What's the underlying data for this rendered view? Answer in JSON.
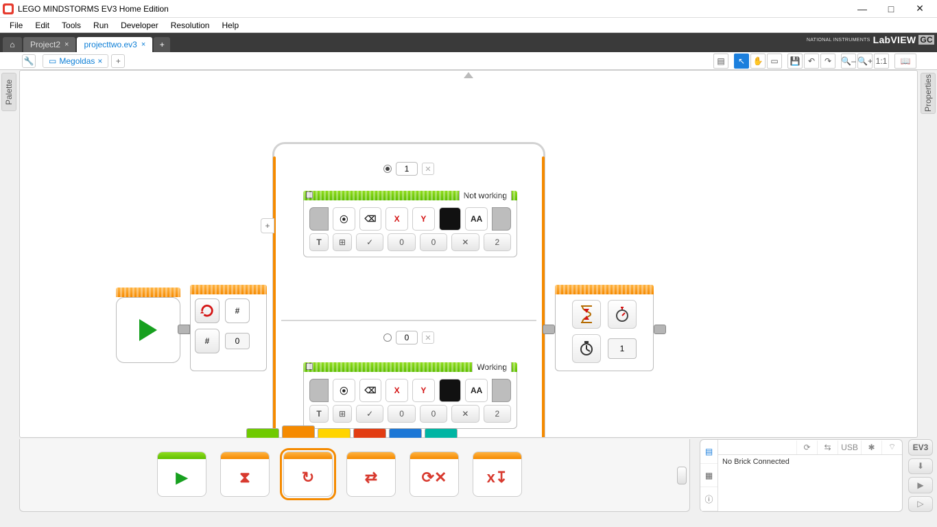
{
  "app": {
    "title": "LEGO MINDSTORMS EV3 Home Edition"
  },
  "menu": [
    "File",
    "Edit",
    "Tools",
    "Run",
    "Developer",
    "Resolution",
    "Help"
  ],
  "project_tabs": {
    "inactive": "Project2",
    "active": "projecttwo.ev3",
    "close": "×",
    "add": "+",
    "logo_main": "LabVIEW",
    "logo_over": "NATIONAL INSTRUMENTS",
    "logo_gc": "GC"
  },
  "program_tab": {
    "name": "Megoldas",
    "close": "×",
    "add": "+"
  },
  "side_tabs": {
    "left": "Palette",
    "right": "Properties"
  },
  "toolbar_icons": {
    "document": "▤",
    "pointer": "↖",
    "hand": "✋",
    "comment": "▭",
    "save": "💾",
    "undo": "↶",
    "redo": "↷",
    "zoom_out": "–",
    "zoom_in": "+",
    "fit": "1:1",
    "help": "📖"
  },
  "switch": {
    "case1_value": "1",
    "case0_value": "0",
    "plus": "+"
  },
  "display_blocks": {
    "top_name": "Not working",
    "bottom_name": "Working",
    "row1": {
      "target": "⦿",
      "erase": "⌫",
      "x": "X",
      "y": "Y",
      "font": "AA"
    },
    "row2": {
      "mode": "T",
      "grid": "⊞",
      "check": "✓",
      "x_val": "0",
      "y_val": "0",
      "color": "✕",
      "font_val": "2"
    }
  },
  "loop": {
    "hash1": "#",
    "hash2": "#",
    "count": "0"
  },
  "wait": {
    "seconds": "1"
  },
  "brick_panel": {
    "status": "No Brick Connected",
    "usb": "USB",
    "refresh": "⟳",
    "expand": "⇆",
    "bt": "✱",
    "wifi": "⌔",
    "ev3": "EV3"
  },
  "action_col": {
    "download": "⬇",
    "play": "▶",
    "run_selection": "▷"
  },
  "palette": {
    "start": "▶",
    "wait": "⧗",
    "loop": "↻",
    "switch": "⇄",
    "interrupt": "⟳✕",
    "variable": "x↧"
  }
}
